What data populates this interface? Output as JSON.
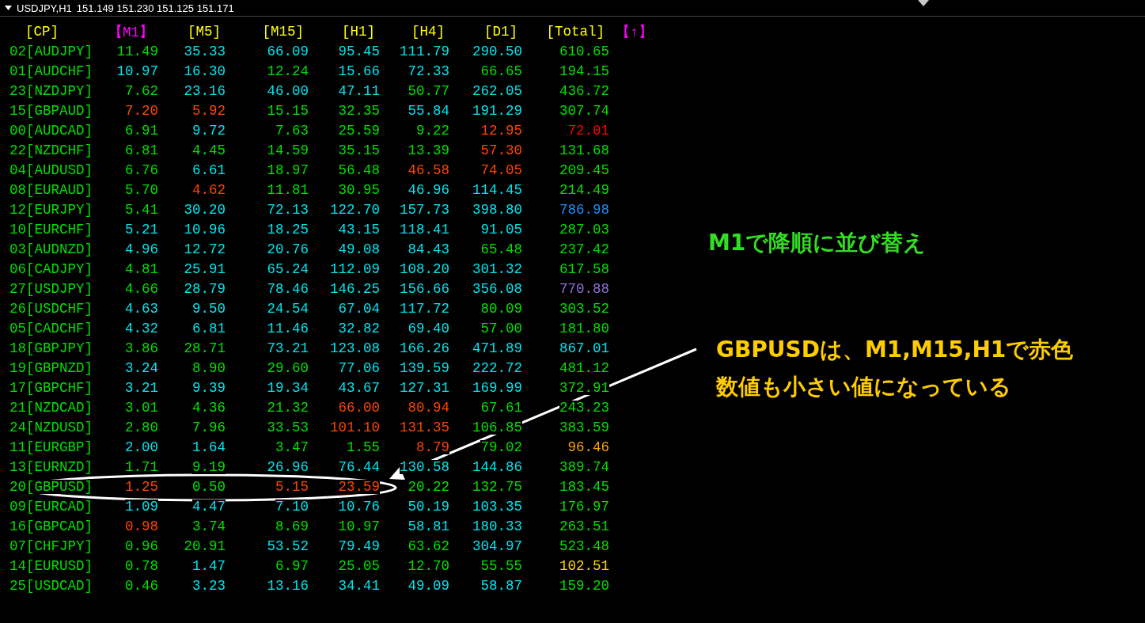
{
  "chart": {
    "title": "USDJPY,H1",
    "prices": "151.149 151.230 151.125 151.171"
  },
  "table": {
    "headers": [
      {
        "text": "[CP]",
        "color": "#ffff00"
      },
      {
        "text": "【M1】",
        "color": "#ff00ff"
      },
      {
        "text": "[M5]",
        "color": "#ffff00"
      },
      {
        "text": "[M15]",
        "color": "#ffff00"
      },
      {
        "text": "[H1]",
        "color": "#ffff00"
      },
      {
        "text": "[H4]",
        "color": "#ffff00"
      },
      {
        "text": "[D1]",
        "color": "#ffff00"
      },
      {
        "text": "[Total]",
        "color": "#ffff00"
      },
      {
        "text": "【↑】",
        "color": "#ff00ff"
      }
    ],
    "rows": [
      {
        "pair": "02[AUDJPY]",
        "cells": [
          {
            "text": "11.49",
            "color": "#00e000"
          },
          {
            "text": "35.33",
            "color": "#00e5ee"
          },
          {
            "text": "66.09",
            "color": "#00e5ee"
          },
          {
            "text": "95.45",
            "color": "#00e5ee"
          },
          {
            "text": "111.79",
            "color": "#00e5ee"
          },
          {
            "text": "290.50",
            "color": "#00e5ee"
          },
          {
            "text": "610.65",
            "color": "#00e000"
          }
        ]
      },
      {
        "pair": "01[AUDCHF]",
        "cells": [
          {
            "text": "10.97",
            "color": "#00e5ee"
          },
          {
            "text": "16.30",
            "color": "#00e5ee"
          },
          {
            "text": "12.24",
            "color": "#00e000"
          },
          {
            "text": "15.66",
            "color": "#00e5ee"
          },
          {
            "text": "72.33",
            "color": "#00e5ee"
          },
          {
            "text": "66.65",
            "color": "#00e000"
          },
          {
            "text": "194.15",
            "color": "#00e000"
          }
        ]
      },
      {
        "pair": "23[NZDJPY]",
        "cells": [
          {
            "text": "7.62",
            "color": "#00e000"
          },
          {
            "text": "23.16",
            "color": "#00e5ee"
          },
          {
            "text": "46.00",
            "color": "#00e5ee"
          },
          {
            "text": "47.11",
            "color": "#00e5ee"
          },
          {
            "text": "50.77",
            "color": "#00e000"
          },
          {
            "text": "262.05",
            "color": "#00e5ee"
          },
          {
            "text": "436.72",
            "color": "#00e000"
          }
        ]
      },
      {
        "pair": "15[GBPAUD]",
        "cells": [
          {
            "text": "7.20",
            "color": "#ff4500"
          },
          {
            "text": "5.92",
            "color": "#ff4500"
          },
          {
            "text": "15.15",
            "color": "#00e000"
          },
          {
            "text": "32.35",
            "color": "#00e000"
          },
          {
            "text": "55.84",
            "color": "#00e5ee"
          },
          {
            "text": "191.29",
            "color": "#00e5ee"
          },
          {
            "text": "307.74",
            "color": "#00e000"
          }
        ]
      },
      {
        "pair": "00[AUDCAD]",
        "cells": [
          {
            "text": "6.91",
            "color": "#00e000"
          },
          {
            "text": "9.72",
            "color": "#00e5ee"
          },
          {
            "text": "7.63",
            "color": "#00e000"
          },
          {
            "text": "25.59",
            "color": "#00e000"
          },
          {
            "text": "9.22",
            "color": "#00e000"
          },
          {
            "text": "12.95",
            "color": "#ff4500"
          },
          {
            "text": "72.01",
            "color": "#ff0000"
          }
        ]
      },
      {
        "pair": "22[NZDCHF]",
        "cells": [
          {
            "text": "6.81",
            "color": "#00e000"
          },
          {
            "text": "4.45",
            "color": "#00e000"
          },
          {
            "text": "14.59",
            "color": "#00e000"
          },
          {
            "text": "35.15",
            "color": "#00e000"
          },
          {
            "text": "13.39",
            "color": "#00e000"
          },
          {
            "text": "57.30",
            "color": "#ff4500"
          },
          {
            "text": "131.68",
            "color": "#00e000"
          }
        ]
      },
      {
        "pair": "04[AUDUSD]",
        "cells": [
          {
            "text": "6.76",
            "color": "#00e000"
          },
          {
            "text": "6.61",
            "color": "#00e5ee"
          },
          {
            "text": "18.97",
            "color": "#00e000"
          },
          {
            "text": "56.48",
            "color": "#00e000"
          },
          {
            "text": "46.58",
            "color": "#ff4500"
          },
          {
            "text": "74.05",
            "color": "#ff4500"
          },
          {
            "text": "209.45",
            "color": "#00e000"
          }
        ]
      },
      {
        "pair": "08[EURAUD]",
        "cells": [
          {
            "text": "5.70",
            "color": "#00e000"
          },
          {
            "text": "4.62",
            "color": "#ff4500"
          },
          {
            "text": "11.81",
            "color": "#00e000"
          },
          {
            "text": "30.95",
            "color": "#00e000"
          },
          {
            "text": "46.96",
            "color": "#00e5ee"
          },
          {
            "text": "114.45",
            "color": "#00e5ee"
          },
          {
            "text": "214.49",
            "color": "#00e000"
          }
        ]
      },
      {
        "pair": "12[EURJPY]",
        "cells": [
          {
            "text": "5.41",
            "color": "#00e000"
          },
          {
            "text": "30.20",
            "color": "#00e5ee"
          },
          {
            "text": "72.13",
            "color": "#00e5ee"
          },
          {
            "text": "122.70",
            "color": "#00e5ee"
          },
          {
            "text": "157.73",
            "color": "#00e5ee"
          },
          {
            "text": "398.80",
            "color": "#00e5ee"
          },
          {
            "text": "786.98",
            "color": "#1e90ff"
          }
        ]
      },
      {
        "pair": "10[EURCHF]",
        "cells": [
          {
            "text": "5.21",
            "color": "#00e5ee"
          },
          {
            "text": "10.96",
            "color": "#00e5ee"
          },
          {
            "text": "18.25",
            "color": "#00e5ee"
          },
          {
            "text": "43.15",
            "color": "#00e5ee"
          },
          {
            "text": "118.41",
            "color": "#00e5ee"
          },
          {
            "text": "91.05",
            "color": "#00e5ee"
          },
          {
            "text": "287.03",
            "color": "#00e000"
          }
        ]
      },
      {
        "pair": "03[AUDNZD]",
        "cells": [
          {
            "text": "4.96",
            "color": "#00e5ee"
          },
          {
            "text": "12.72",
            "color": "#00e5ee"
          },
          {
            "text": "20.76",
            "color": "#00e5ee"
          },
          {
            "text": "49.08",
            "color": "#00e5ee"
          },
          {
            "text": "84.43",
            "color": "#00e5ee"
          },
          {
            "text": "65.48",
            "color": "#00e000"
          },
          {
            "text": "237.42",
            "color": "#00e000"
          }
        ]
      },
      {
        "pair": "06[CADJPY]",
        "cells": [
          {
            "text": "4.81",
            "color": "#00e000"
          },
          {
            "text": "25.91",
            "color": "#00e5ee"
          },
          {
            "text": "65.24",
            "color": "#00e5ee"
          },
          {
            "text": "112.09",
            "color": "#00e5ee"
          },
          {
            "text": "108.20",
            "color": "#00e5ee"
          },
          {
            "text": "301.32",
            "color": "#00e5ee"
          },
          {
            "text": "617.58",
            "color": "#00e000"
          }
        ]
      },
      {
        "pair": "27[USDJPY]",
        "cells": [
          {
            "text": "4.66",
            "color": "#00e000"
          },
          {
            "text": "28.79",
            "color": "#00e5ee"
          },
          {
            "text": "78.46",
            "color": "#00e5ee"
          },
          {
            "text": "146.25",
            "color": "#00e5ee"
          },
          {
            "text": "156.66",
            "color": "#00e5ee"
          },
          {
            "text": "356.08",
            "color": "#00e5ee"
          },
          {
            "text": "770.88",
            "color": "#9370db"
          }
        ]
      },
      {
        "pair": "26[USDCHF]",
        "cells": [
          {
            "text": "4.63",
            "color": "#00e5ee"
          },
          {
            "text": "9.50",
            "color": "#00e5ee"
          },
          {
            "text": "24.54",
            "color": "#00e5ee"
          },
          {
            "text": "67.04",
            "color": "#00e5ee"
          },
          {
            "text": "117.72",
            "color": "#00e5ee"
          },
          {
            "text": "80.09",
            "color": "#00e000"
          },
          {
            "text": "303.52",
            "color": "#00e000"
          }
        ]
      },
      {
        "pair": "05[CADCHF]",
        "cells": [
          {
            "text": "4.32",
            "color": "#00e5ee"
          },
          {
            "text": "6.81",
            "color": "#00e5ee"
          },
          {
            "text": "11.46",
            "color": "#00e5ee"
          },
          {
            "text": "32.82",
            "color": "#00e5ee"
          },
          {
            "text": "69.40",
            "color": "#00e5ee"
          },
          {
            "text": "57.00",
            "color": "#00e000"
          },
          {
            "text": "181.80",
            "color": "#00e000"
          }
        ]
      },
      {
        "pair": "18[GBPJPY]",
        "cells": [
          {
            "text": "3.86",
            "color": "#00e000"
          },
          {
            "text": "28.71",
            "color": "#00e000"
          },
          {
            "text": "73.21",
            "color": "#00e5ee"
          },
          {
            "text": "123.08",
            "color": "#00e5ee"
          },
          {
            "text": "166.26",
            "color": "#00e5ee"
          },
          {
            "text": "471.89",
            "color": "#00e5ee"
          },
          {
            "text": "867.01",
            "color": "#00e5ee"
          }
        ]
      },
      {
        "pair": "19[GBPNZD]",
        "cells": [
          {
            "text": "3.24",
            "color": "#00e5ee"
          },
          {
            "text": "8.90",
            "color": "#00e000"
          },
          {
            "text": "29.60",
            "color": "#00e000"
          },
          {
            "text": "77.06",
            "color": "#00e5ee"
          },
          {
            "text": "139.59",
            "color": "#00e5ee"
          },
          {
            "text": "222.72",
            "color": "#00e5ee"
          },
          {
            "text": "481.12",
            "color": "#00e000"
          }
        ]
      },
      {
        "pair": "17[GBPCHF]",
        "cells": [
          {
            "text": "3.21",
            "color": "#00e5ee"
          },
          {
            "text": "9.39",
            "color": "#00e5ee"
          },
          {
            "text": "19.34",
            "color": "#00e5ee"
          },
          {
            "text": "43.67",
            "color": "#00e5ee"
          },
          {
            "text": "127.31",
            "color": "#00e5ee"
          },
          {
            "text": "169.99",
            "color": "#00e5ee"
          },
          {
            "text": "372.91",
            "color": "#00e000"
          }
        ]
      },
      {
        "pair": "21[NZDCAD]",
        "cells": [
          {
            "text": "3.01",
            "color": "#00e000"
          },
          {
            "text": "4.36",
            "color": "#00e000"
          },
          {
            "text": "21.32",
            "color": "#00e000"
          },
          {
            "text": "66.00",
            "color": "#ff4500"
          },
          {
            "text": "80.94",
            "color": "#ff4500"
          },
          {
            "text": "67.61",
            "color": "#00e000"
          },
          {
            "text": "243.23",
            "color": "#00e000"
          }
        ]
      },
      {
        "pair": "24[NZDUSD]",
        "cells": [
          {
            "text": "2.80",
            "color": "#00e000"
          },
          {
            "text": "7.96",
            "color": "#00e000"
          },
          {
            "text": "33.53",
            "color": "#00e000"
          },
          {
            "text": "101.10",
            "color": "#ff4500"
          },
          {
            "text": "131.35",
            "color": "#ff4500"
          },
          {
            "text": "106.85",
            "color": "#00e000"
          },
          {
            "text": "383.59",
            "color": "#00e000"
          }
        ]
      },
      {
        "pair": "11[EURGBP]",
        "cells": [
          {
            "text": "2.00",
            "color": "#00e5ee"
          },
          {
            "text": "1.64",
            "color": "#00e5ee"
          },
          {
            "text": "3.47",
            "color": "#00e000"
          },
          {
            "text": "1.55",
            "color": "#00e000"
          },
          {
            "text": "8.79",
            "color": "#ff4500"
          },
          {
            "text": "79.02",
            "color": "#00e000"
          },
          {
            "text": "96.46",
            "color": "#ffa500"
          }
        ]
      },
      {
        "pair": "13[EURNZD]",
        "cells": [
          {
            "text": "1.71",
            "color": "#00e000"
          },
          {
            "text": "9.19",
            "color": "#00e000"
          },
          {
            "text": "26.96",
            "color": "#00e5ee"
          },
          {
            "text": "76.44",
            "color": "#00e5ee"
          },
          {
            "text": "130.58",
            "color": "#00e5ee"
          },
          {
            "text": "144.86",
            "color": "#00e5ee"
          },
          {
            "text": "389.74",
            "color": "#00e000"
          }
        ]
      },
      {
        "pair": "20[GBPUSD]",
        "cells": [
          {
            "text": "1.25",
            "color": "#ff4500"
          },
          {
            "text": "0.50",
            "color": "#00e000"
          },
          {
            "text": "5.15",
            "color": "#ff4500"
          },
          {
            "text": "23.59",
            "color": "#ff4500"
          },
          {
            "text": "20.22",
            "color": "#00e000"
          },
          {
            "text": "132.75",
            "color": "#00e000"
          },
          {
            "text": "183.45",
            "color": "#00e000"
          }
        ]
      },
      {
        "pair": "09[EURCAD]",
        "cells": [
          {
            "text": "1.09",
            "color": "#00e5ee"
          },
          {
            "text": "4.47",
            "color": "#00e5ee"
          },
          {
            "text": "7.10",
            "color": "#00e5ee"
          },
          {
            "text": "10.76",
            "color": "#00e5ee"
          },
          {
            "text": "50.19",
            "color": "#00e5ee"
          },
          {
            "text": "103.35",
            "color": "#00e5ee"
          },
          {
            "text": "176.97",
            "color": "#00e000"
          }
        ]
      },
      {
        "pair": "16[GBPCAD]",
        "cells": [
          {
            "text": "0.98",
            "color": "#ff4500"
          },
          {
            "text": "3.74",
            "color": "#00e000"
          },
          {
            "text": "8.69",
            "color": "#00e000"
          },
          {
            "text": "10.97",
            "color": "#00e000"
          },
          {
            "text": "58.81",
            "color": "#00e5ee"
          },
          {
            "text": "180.33",
            "color": "#00e5ee"
          },
          {
            "text": "263.51",
            "color": "#00e000"
          }
        ]
      },
      {
        "pair": "07[CHFJPY]",
        "cells": [
          {
            "text": "0.96",
            "color": "#00e000"
          },
          {
            "text": "20.91",
            "color": "#00e000"
          },
          {
            "text": "53.52",
            "color": "#00e5ee"
          },
          {
            "text": "79.49",
            "color": "#00e5ee"
          },
          {
            "text": "63.62",
            "color": "#00e000"
          },
          {
            "text": "304.97",
            "color": "#00e5ee"
          },
          {
            "text": "523.48",
            "color": "#00e000"
          }
        ]
      },
      {
        "pair": "14[EURUSD]",
        "cells": [
          {
            "text": "0.78",
            "color": "#00e000"
          },
          {
            "text": "1.47",
            "color": "#00e5ee"
          },
          {
            "text": "6.97",
            "color": "#00e000"
          },
          {
            "text": "25.05",
            "color": "#00e000"
          },
          {
            "text": "12.70",
            "color": "#00e000"
          },
          {
            "text": "55.55",
            "color": "#00e000"
          },
          {
            "text": "102.51",
            "color": "#ffd700"
          }
        ]
      },
      {
        "pair": "25[USDCAD]",
        "cells": [
          {
            "text": "0.46",
            "color": "#00e000"
          },
          {
            "text": "3.23",
            "color": "#00e5ee"
          },
          {
            "text": "13.16",
            "color": "#00e5ee"
          },
          {
            "text": "34.41",
            "color": "#00e5ee"
          },
          {
            "text": "49.09",
            "color": "#00e5ee"
          },
          {
            "text": "58.87",
            "color": "#00e5ee"
          },
          {
            "text": "159.20",
            "color": "#00e000"
          }
        ]
      }
    ]
  },
  "annotations": {
    "sort_note": "M1で降順に並び替え",
    "red_note": [
      "GBPUSDは、M1,M15,H1で赤色",
      "数値も小さい値になっている"
    ]
  }
}
